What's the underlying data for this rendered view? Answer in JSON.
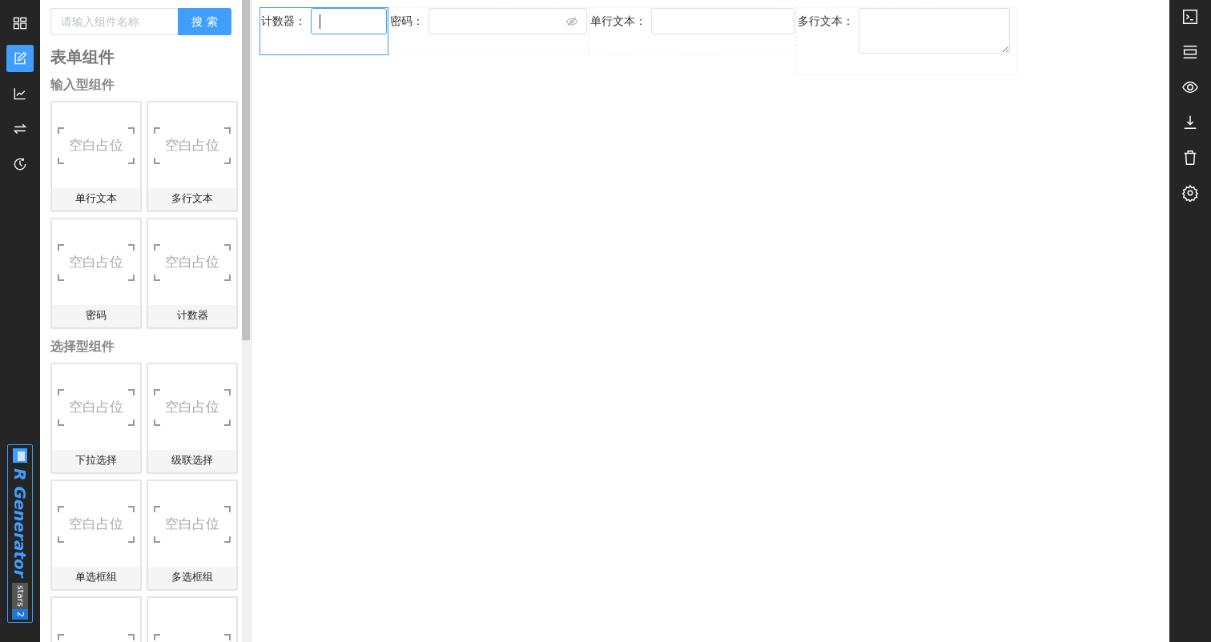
{
  "left_nav": [
    {
      "selected": false
    },
    {
      "selected": true
    },
    {
      "selected": false
    },
    {
      "selected": false
    },
    {
      "selected": false
    }
  ],
  "logo": {
    "name": "R Generator",
    "badge_label": "stars",
    "badge_count": "2"
  },
  "components_panel": {
    "search": {
      "placeholder": "请输入组件名称",
      "button": "搜 索"
    },
    "title": "表单组件",
    "groups": [
      {
        "heading": "输入型组件",
        "items": [
          {
            "kind": "card",
            "placeholder": "空白占位",
            "label": "单行文本"
          },
          {
            "kind": "card",
            "placeholder": "空白占位",
            "label": "多行文本"
          },
          {
            "kind": "card",
            "placeholder": "空白占位",
            "label": "密码"
          },
          {
            "kind": "card",
            "placeholder": "空白占位",
            "label": "计数器"
          }
        ]
      },
      {
        "heading": "选择型组件",
        "items": [
          {
            "kind": "card",
            "placeholder": "空白占位",
            "label": "下拉选择"
          },
          {
            "kind": "card",
            "placeholder": "空白占位",
            "label": "级联选择"
          },
          {
            "kind": "card",
            "placeholder": "空白占位",
            "label": "单选框组"
          },
          {
            "kind": "card",
            "placeholder": "空白占位",
            "label": "多选框组"
          },
          {
            "kind": "cut"
          },
          {
            "kind": "cut"
          }
        ]
      }
    ]
  },
  "form_canvas": {
    "fields": [
      {
        "kind": "number",
        "label": "计数器：",
        "selected": true
      },
      {
        "kind": "password",
        "label": "密码：",
        "selected": false
      },
      {
        "kind": "text",
        "label": "单行文本：",
        "selected": false
      },
      {
        "kind": "textarea",
        "label": "多行文本：",
        "selected": false
      }
    ]
  }
}
